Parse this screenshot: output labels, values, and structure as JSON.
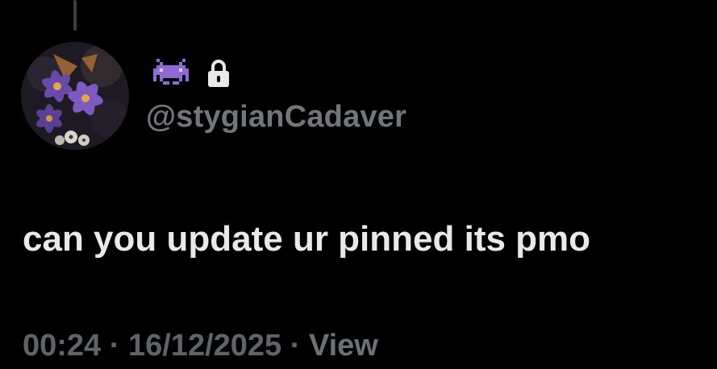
{
  "tweet": {
    "display_name_icon": "alien-monster-emoji",
    "lock_icon": "lock-icon",
    "handle": "@stygianCadaver",
    "text": "can you update ur pinned its pmo",
    "time": "00:24",
    "separator": "·",
    "date": "16/12/2025",
    "views_label": "View"
  },
  "colors": {
    "background": "#000000",
    "primary_text": "#e7e9ea",
    "secondary_text": "#71767b",
    "emoji_purple": "#8f6ad6"
  }
}
